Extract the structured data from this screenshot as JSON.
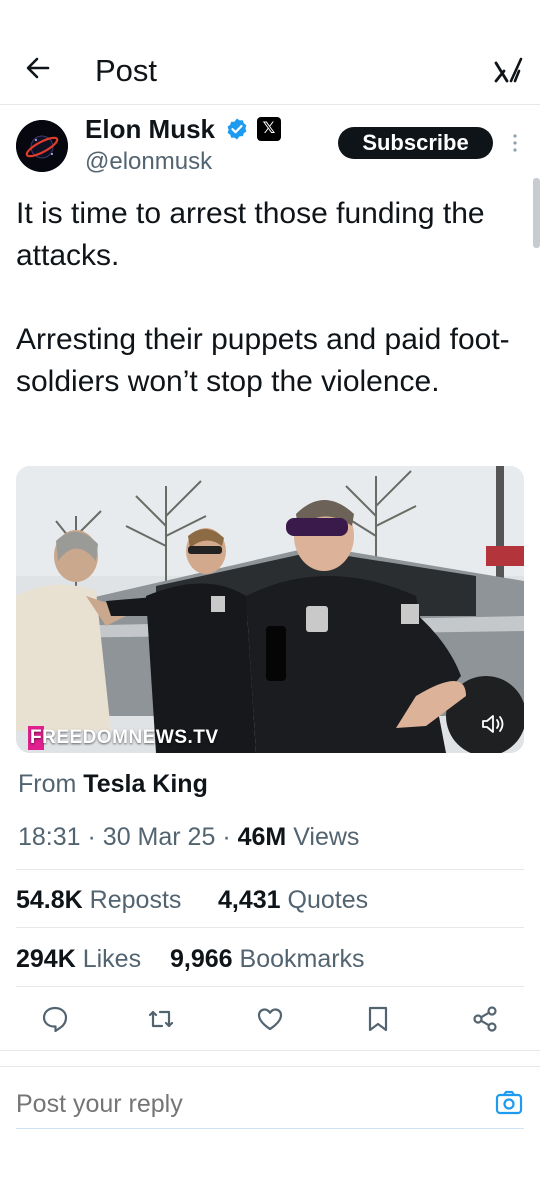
{
  "header": {
    "title": "Post",
    "back_icon": "arrow-left-icon",
    "logo_icon": "grok-logo-icon"
  },
  "author": {
    "name": "Elon Musk",
    "handle": "@elonmusk",
    "subscribe_label": "Subscribe",
    "x_badge": "𝕏",
    "verified_color": "#1d9bf0"
  },
  "tweet": {
    "text": "It is time to arrest those funding the attacks.\n\nArresting their puppets and paid foot-soldiers won’t stop the violence."
  },
  "media": {
    "watermark": "FREEDOMNEWS.TV",
    "sound_icon": "speaker-icon"
  },
  "meta": {
    "from_prefix": "From",
    "from_source": "Tesla King",
    "time": "18:31",
    "date": "30 Mar 25",
    "views_count": "46M",
    "views_label": "Views",
    "sep": "·"
  },
  "stats": {
    "reposts_count": "54.8K",
    "reposts_label": "Reposts",
    "quotes_count": "4,431",
    "quotes_label": "Quotes",
    "likes_count": "294K",
    "likes_label": "Likes",
    "bookmarks_count": "9,966",
    "bookmarks_label": "Bookmarks"
  },
  "actions": [
    "reply-icon",
    "repost-icon",
    "like-icon",
    "bookmark-icon",
    "share-icon"
  ],
  "reply_box": {
    "placeholder": "Post your reply",
    "camera_icon": "camera-icon"
  },
  "colors": {
    "text": "#0f1419",
    "muted": "#536471",
    "accent": "#1d9bf0",
    "divider": "#e6e9ec"
  }
}
